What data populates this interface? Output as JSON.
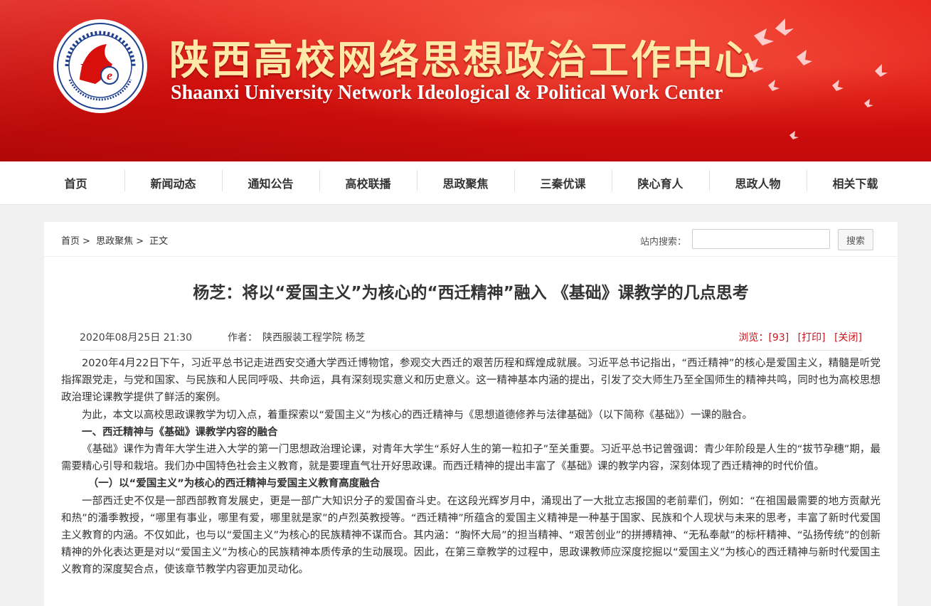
{
  "header": {
    "title_cn": "陕西高校网络思想政治工作中心",
    "title_en": "Shaanxi University Network Ideological & Political Work Center",
    "logo_icon": "university-seal-logo",
    "brand_red": "#d7100d",
    "title_gold": "#ffe9a8"
  },
  "nav": {
    "items": [
      "首页",
      "新闻动态",
      "通知公告",
      "高校联播",
      "思政聚焦",
      "三秦优课",
      "陕心育人",
      "思政人物",
      "相关下载"
    ]
  },
  "breadcrumb": {
    "home": "首页",
    "sep1": ">",
    "section": "思政聚焦",
    "sep2": ">",
    "current": "正文"
  },
  "search": {
    "label": "站内搜索：",
    "value": "",
    "button": "搜索"
  },
  "article": {
    "title": "杨芝：将以“爱国主义”为核心的“西迁精神”融入 《基础》课教学的几点思考",
    "date": "2020年08月25日 21:30",
    "author_label": "作者：",
    "author": "陕西服装工程学院 杨芝",
    "views_label": "浏览：",
    "views": "[93]",
    "print": "[打印]",
    "close": "[关闭]",
    "accent": "#c8161d",
    "p1": "2020年4月22日下午，习近平总书记走进西安交通大学西迁博物馆，参观交大西迁的艰苦历程和辉煌成就展。习近平总书记指出，“西迁精神”的核心是爱国主义，精髓是听党指挥跟党走，与党和国家、与民族和人民同呼吸、共命运，具有深刻现实意义和历史意义。这一精神基本内涵的提出，引发了交大师生乃至全国师生的精神共鸣，同时也为高校思想政治理论课教学提供了鲜活的案例。",
    "p2": "为此，本文以高校思政课教学为切入点，着重探索以“爱国主义”为核心的西迁精神与《思想道德修养与法律基础》（以下简称《基础》）一课的融合。",
    "h1": "一、西迁精神与《基础》课教学内容的融合",
    "p3": "《基础》课作为青年大学生进入大学的第一门思想政治理论课，对青年大学生“系好人生的第一粒扣子”至关重要。习近平总书记曾强调：青少年阶段是人生的“拔节孕穗”期，最需要精心引导和栽培。我们办中国特色社会主义教育，就是要理直气壮开好思政课。而西迁精神的提出丰富了《基础》课的教学内容，深刻体现了西迁精神的时代价值。",
    "h2": "（一）以“爱国主义”为核心的西迁精神与爱国主义教育高度融合",
    "p4": "一部西迁史不仅是一部西部教育发展史，更是一部广大知识分子的爱国奋斗史。在这段光辉岁月中，涌现出了一大批立志报国的老前辈们，例如：“在祖国最需要的地方贡献光和热”的潘季教授，“哪里有事业，哪里有爱，哪里就是家”的卢烈英教授等。“西迁精神”所蕴含的爱国主义精神是一种基于国家、民族和个人现状与未来的思考，丰富了新时代爱国主义教育的内涵。不仅如此，也与以“爱国主义”为核心的民族精神不谋而合。其内涵：“胸怀大局”的担当精神、“艰苦创业”的拼搏精神、“无私奉献”的标杆精神、“弘扬传统”的创新精神的外化表达更是对以“爱国主义”为核心的民族精神本质传承的生动展现。因此，在第三章教学的过程中，思政课教师应深度挖掘以“爱国主义”为核心的西迁精神与新时代爱国主义教育的深度契合点，使该章节教学内容更加灵动化。"
  }
}
